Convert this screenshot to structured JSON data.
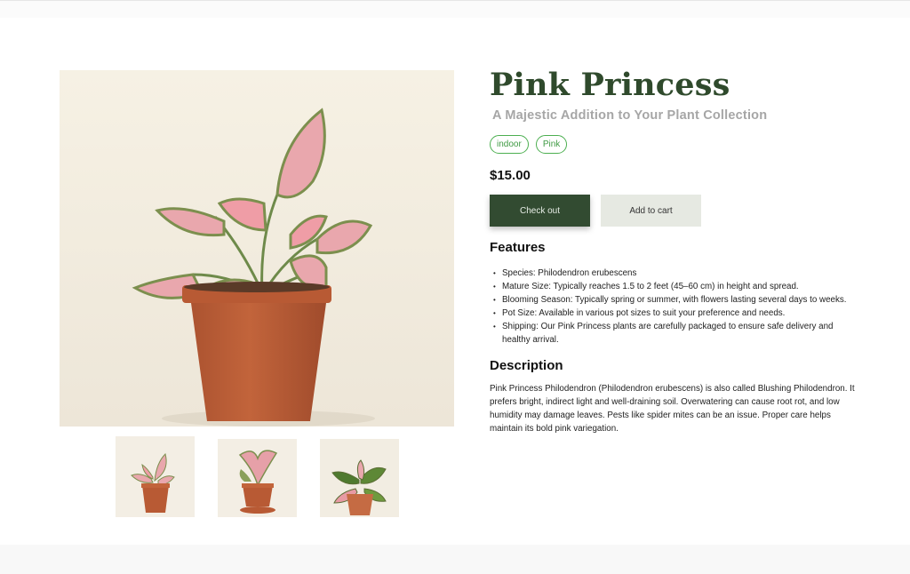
{
  "product": {
    "title": "Pink Princess",
    "subtitle": "A Majestic Addition to Your Plant Collection",
    "tags": [
      "indoor",
      "Pink"
    ],
    "price": "$15.00"
  },
  "actions": {
    "checkout_label": "Check out",
    "add_to_cart_label": "Add to cart"
  },
  "features": {
    "heading": "Features",
    "items": [
      "Species: Philodendron erubescens",
      "Mature Size: Typically reaches 1.5 to 2 feet (45–60 cm) in height and spread.",
      "Blooming Season: Typically spring or summer, with flowers lasting several days to weeks.",
      "Pot Size: Available in various pot sizes to suit your preference and needs.",
      "Shipping: Our Pink Princess plants are carefully packaged to ensure safe delivery and healthy arrival."
    ]
  },
  "description": {
    "heading": "Description",
    "text": "Pink Princess Philodendron (Philodendron erubescens) is also called Blushing Philodendron. It prefers bright, indirect light and well-draining soil. Overwatering can cause root rot, and low humidity may damage leaves. Pests like spider mites can be an issue. Proper care helps maintain its bold pink variegation."
  },
  "gallery": {
    "thumbnail_count": 3,
    "selected_index": 0
  },
  "colors": {
    "brand_green": "#324b31",
    "title_green": "#2f4a2c",
    "tag_green": "#4caf50",
    "pot_terracotta": "#b85a34",
    "leaf_pink": "#e9a7ad"
  }
}
